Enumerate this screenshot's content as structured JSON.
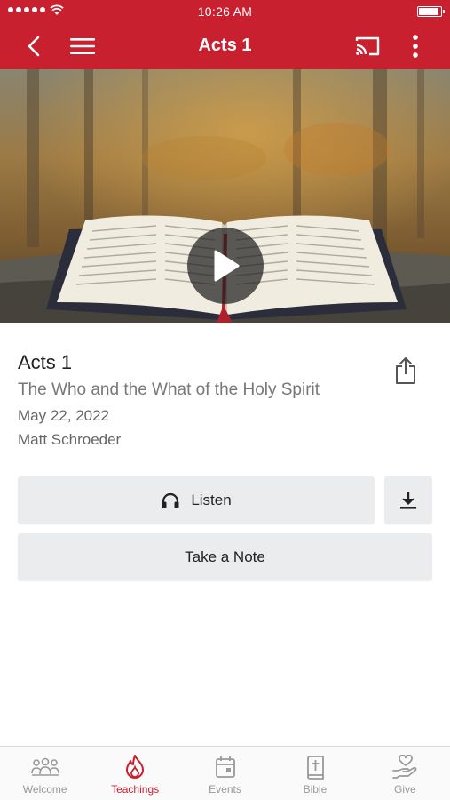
{
  "status_bar": {
    "time": "10:26 AM"
  },
  "nav": {
    "title": "Acts 1",
    "back_icon": "chevron-left-icon",
    "menu_icon": "hamburger-menu-icon",
    "cast_icon": "cast-icon",
    "more_icon": "more-vertical-icon"
  },
  "media": {
    "play_icon": "play-icon"
  },
  "episode": {
    "title": "Acts 1",
    "subtitle": "The Who and the What of the Holy Spirit",
    "date": "May 22, 2022",
    "speaker": "Matt Schroeder"
  },
  "actions": {
    "listen_label": "Listen",
    "take_note_label": "Take a Note",
    "share_icon": "share-icon",
    "download_icon": "download-icon",
    "headphones_icon": "headphones-icon"
  },
  "tabs": [
    {
      "label": "Welcome",
      "icon": "people-icon",
      "active": false
    },
    {
      "label": "Teachings",
      "icon": "flame-icon",
      "active": true
    },
    {
      "label": "Events",
      "icon": "calendar-icon",
      "active": false
    },
    {
      "label": "Bible",
      "icon": "bible-icon",
      "active": false
    },
    {
      "label": "Give",
      "icon": "heart-hand-icon",
      "active": false
    }
  ],
  "colors": {
    "brand": "#c8202f",
    "button_bg": "#ebecee",
    "tab_inactive": "#999999"
  }
}
